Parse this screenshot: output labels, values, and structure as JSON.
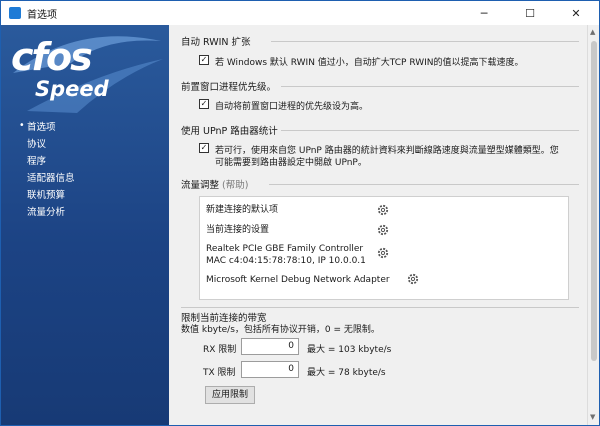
{
  "window": {
    "title": "首选项"
  },
  "titlebar_buttons": {
    "minimize": "─",
    "maximize": "☐",
    "close": "✕"
  },
  "logo": {
    "line1": "cfos",
    "line2": "Speed"
  },
  "sidebar": {
    "items": [
      {
        "label": "首选项",
        "active": true
      },
      {
        "label": "协议"
      },
      {
        "label": "程序"
      },
      {
        "label": "适配器信息"
      },
      {
        "label": "联机预算"
      },
      {
        "label": "流量分析"
      }
    ]
  },
  "sections": {
    "rwin": {
      "title": "自动 RWIN 扩张",
      "checkbox_label": "若 Windows 默认 RWIN 值过小，自动扩大TCP RWIN的值以提高下载速度。",
      "checked": true
    },
    "foreground": {
      "title": "前置窗口进程优先级。",
      "checkbox_label": "自动将前置窗口进程的优先级设为高。",
      "checked": true
    },
    "upnp": {
      "title": "使用 UPnP 路由器统计",
      "checkbox_label_line1": "若可行，使用來自您 UPnP 路由器的統計資料來判斷線路速度與流量塑型媒體類型。您",
      "checkbox_label_line2": "可能需要到路由器設定中開啟 UPnP。",
      "checked": true
    },
    "traffic": {
      "title": "流量调整",
      "help_link": "(帮助)",
      "items": [
        {
          "line1": "新建连接的默认项"
        },
        {
          "line1": "当前连接的设置"
        },
        {
          "line1": "Realtek PCIe GBE Family Controller",
          "line2": "MAC c4:04:15:78:78:10, IP 10.0.0.1"
        },
        {
          "line1": "Microsoft Kernel Debug Network Adapter"
        }
      ]
    },
    "bandwidth": {
      "title": "限制当前连接的带宽",
      "description": "数值 kbyte/s，包括所有协议开销，0 = 无限制。",
      "rx": {
        "label": "RX 限制",
        "value": "0",
        "max": "最大 = 103 kbyte/s"
      },
      "tx": {
        "label": "TX 限制",
        "value": "0",
        "max": "最大 = 78 kbyte/s"
      },
      "apply_button": "应用限制"
    }
  },
  "colors": {
    "sidebar_top": "#2a5a9c",
    "sidebar_bottom": "#173a75",
    "window_border": "#1e5fb0"
  }
}
